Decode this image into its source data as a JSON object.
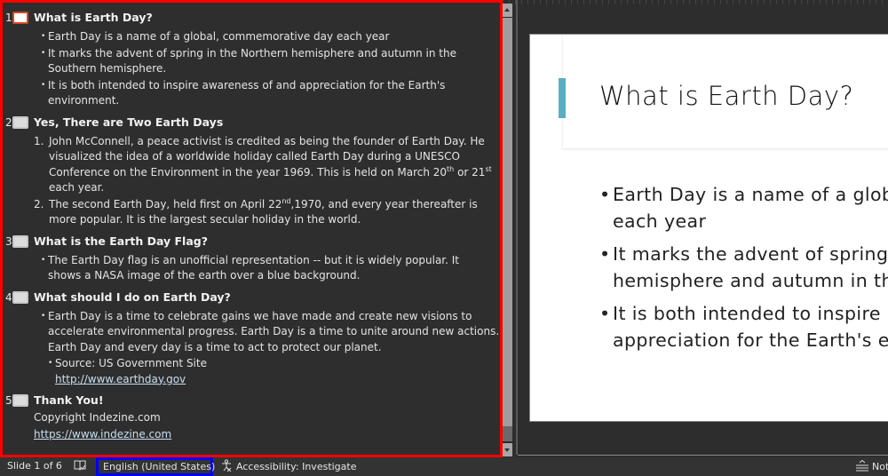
{
  "outline": {
    "slides": [
      {
        "number": "1",
        "title": "What is Earth Day?",
        "active": true,
        "bullets": [
          "Earth Day is a name of a global, commemorative day each year",
          "It marks the advent of spring in the Northern hemisphere and autumn in the Southern hemisphere.",
          "It is both intended to inspire awareness of and appreciation for the Earth's environment."
        ]
      },
      {
        "number": "2",
        "title": "Yes, There are Two Earth Days",
        "numbered": [
          {
            "n": "1.",
            "text_a": "John McConnell, a peace activist is credited as being the founder of Earth Day. He visualized the idea of a worldwide holiday called Earth Day during a UNESCO Conference on the Environment in the year 1969. This is held on March 20",
            "sup_a": "th",
            "text_b": " or 21",
            "sup_b": "st",
            "text_c": " each year."
          },
          {
            "n": "2.",
            "text_a": "The second Earth Day, held first on April 22",
            "sup_a": "nd",
            "text_b": ",1970, and every year thereafter is more popular. It is the largest secular holiday in the world."
          }
        ]
      },
      {
        "number": "3",
        "title": "What is the Earth Day Flag?",
        "bullets": [
          "The Earth Day flag is an unofficial representation -- but it is widely popular. It shows a NASA image of the earth over a blue background."
        ]
      },
      {
        "number": "4",
        "title": "What should I do on Earth Day?",
        "bullets": [
          "Earth Day is a time to celebrate gains we have made and create new visions to accelerate environmental progress. Earth Day is a time to unite around new actions. Earth Day and every day is a time to act to protect our planet."
        ],
        "sub_bullet": "Source: US Government Site",
        "link": "http://www.earthday.gov"
      },
      {
        "number": "5",
        "title": "Thank You!",
        "plain": "Copyright Indezine.com",
        "link": "https://www.indezine.com"
      }
    ]
  },
  "slide_view": {
    "title": "What is Earth Day?",
    "bullets": [
      [
        "Earth Day is a name of a global, commemorative day",
        "each year"
      ],
      [
        "It marks the advent of spring in the Northern",
        "hemisphere and autumn in the Southern hemisphere."
      ],
      [
        "It is both intended to inspire awareness of and",
        "appreciation for the Earth's environment."
      ]
    ],
    "accent_color": "#5aaec4"
  },
  "statusbar": {
    "slide_count": "Slide 1 of 6",
    "language": "English (United States)",
    "accessibility": "Accessibility: Investigate",
    "notes": "Notes"
  }
}
